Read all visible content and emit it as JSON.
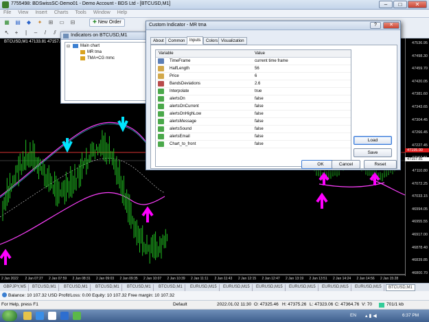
{
  "window": {
    "title": "7755498: BDSwissSC-Demo01 - Demo Account - BDS Ltd - [BTCUSD,M1]",
    "minimize": "–",
    "maximize": "□",
    "close": "✕"
  },
  "menu": [
    "File",
    "View",
    "Insert",
    "Charts",
    "Tools",
    "Window",
    "Help"
  ],
  "toolbar": {
    "new_order": "New Order"
  },
  "chart": {
    "label": "BTCUSD,M1  47133.81 47157.81 47",
    "price_ticks": [
      "47536.95",
      "47498.30",
      "47459.70",
      "47420.05",
      "47381.60",
      "47343.65",
      "47304.45",
      "47266.45",
      "47227.45",
      "47157.81",
      "47110.80",
      "47072.25",
      "47033.15",
      "46994.05",
      "46955.55",
      "46917.00",
      "46878.40",
      "46839.85",
      "46800.70"
    ],
    "red_tag": "47195.00",
    "blue_tag": "47157.81",
    "time_ticks": [
      "2 Jan 2022",
      "2 Jan 07:27",
      "2 Jan 07:59",
      "2 Jan 08:31",
      "2 Jan 09:03",
      "2 Jan 09:35",
      "2 Jan 10:07",
      "2 Jan 10:39",
      "2 Jan 11:11",
      "2 Jan 11:43",
      "2 Jan 12:15",
      "2 Jan 12:47",
      "2 Jan 13:19",
      "2 Jan 13:51",
      "2 Jan 14:24",
      "2 Jan 14:56",
      "2 Jan 15:28"
    ]
  },
  "chart_tabs": [
    "GBPJPY,M5",
    "BTCUSD,M1",
    "BTCUSD,M1",
    "BTCUSD,M1",
    "BTCUSD,M1",
    "BTCUSD,M1",
    "EURUSD,M15",
    "EURUSD,M15",
    "EURUSD,M15",
    "EURUSD,M15",
    "EURUSD,M15",
    "EURUSD,M15",
    "BTCUSD,M1"
  ],
  "terminal": {
    "balance": "Balance: 10 107.32 USD  Profit/Loss: 0.00  Equity: 10 107.32  Free margin: 10 107.32"
  },
  "status": {
    "help": "For Help, press F1",
    "profile": "Default",
    "datetime": "2022.01.02 11:30",
    "open": "O: 47325.46",
    "high": "H: 47375.26",
    "low": "L: 47323.06",
    "close": "C: 47364.76",
    "volume": "V: 70",
    "traffic": "701/1 kb"
  },
  "taskbar": {
    "lang": "EN",
    "clock": "6:37 PM"
  },
  "indicators_window": {
    "title": "Indicators on BTCUSD,M1",
    "root": "Main chart",
    "items": [
      "MR tma",
      "TMA+CG mmc"
    ]
  },
  "dialog": {
    "title": "Custom Indicator - MR tma",
    "help": "?",
    "tabs": [
      "About",
      "Common",
      "Inputs",
      "Colors",
      "Visualization"
    ],
    "active_tab": "Inputs",
    "col_variable": "Variable",
    "col_value": "Value",
    "params": [
      {
        "name": "TimeFrame",
        "value": "current time frame",
        "icon": "enum",
        "selected": false
      },
      {
        "name": "HalfLength",
        "value": "56",
        "icon": "int",
        "selected": false
      },
      {
        "name": "Price",
        "value": "6",
        "icon": "int",
        "selected": false
      },
      {
        "name": "BandsDeviations",
        "value": "2.6",
        "icon": "double",
        "selected": false
      },
      {
        "name": "Interpolate",
        "value": "true",
        "icon": "bool",
        "selected": false
      },
      {
        "name": "alertsOn",
        "value": "false",
        "icon": "bool",
        "selected": false
      },
      {
        "name": "alertsOnCurrent",
        "value": "false",
        "icon": "bool",
        "selected": false
      },
      {
        "name": "alertsOnHighLow",
        "value": "false",
        "icon": "bool",
        "selected": false
      },
      {
        "name": "alertsMessage",
        "value": "false",
        "icon": "bool",
        "selected": false
      },
      {
        "name": "alertsSound",
        "value": "false",
        "icon": "bool",
        "selected": false
      },
      {
        "name": "alertsEmail",
        "value": "false",
        "icon": "bool",
        "selected": false
      },
      {
        "name": "Chart_to_front",
        "value": "false",
        "icon": "bool",
        "selected": false
      }
    ],
    "load": "Load",
    "save": "Save",
    "ok": "OK",
    "cancel": "Cancel",
    "reset": "Reset"
  },
  "colors": {
    "up_arrow": "#ff00ff",
    "down_arrow": "#00e5ff",
    "candles": "#22c322",
    "band_upper": "#ff40ff",
    "band_mid": "#ffffff"
  }
}
